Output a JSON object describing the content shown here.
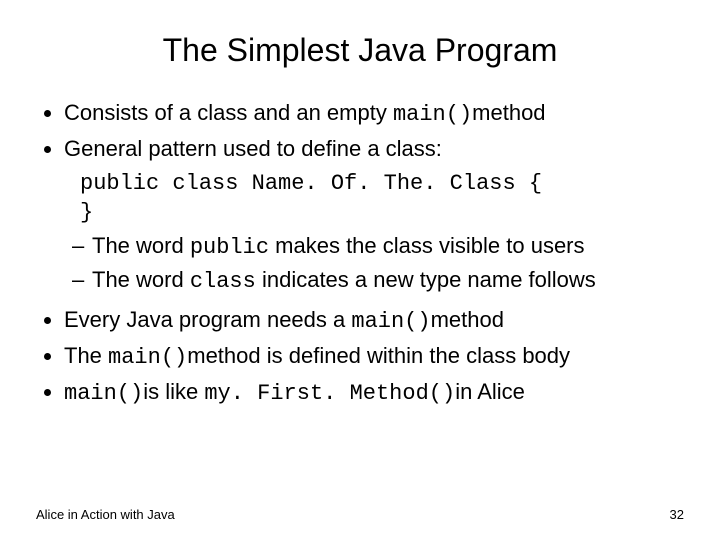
{
  "title": "The Simplest Java Program",
  "bullets": {
    "b1_a": "Consists of a class and an empty ",
    "b1_code": "main()",
    "b1_b": "method",
    "b2": "General pattern used to define a class:",
    "code_line1": "public class Name. Of. The. Class {",
    "code_line2": "}",
    "sub1_a": "The word ",
    "sub1_code": "public",
    "sub1_b": " makes the class visible to users",
    "sub2_a": "The word ",
    "sub2_code": "class",
    "sub2_b": " indicates a new type name follows",
    "b3_a": "Every Java program needs a ",
    "b3_code": "main()",
    "b3_b": "method",
    "b4_a": "The ",
    "b4_code": "main()",
    "b4_b": "method is defined within the class body",
    "b5_code1": "main()",
    "b5_mid": "is like ",
    "b5_code2": "my. First. Method()",
    "b5_end": "in Alice"
  },
  "footer": {
    "left": "Alice in Action with Java",
    "right": "32"
  }
}
